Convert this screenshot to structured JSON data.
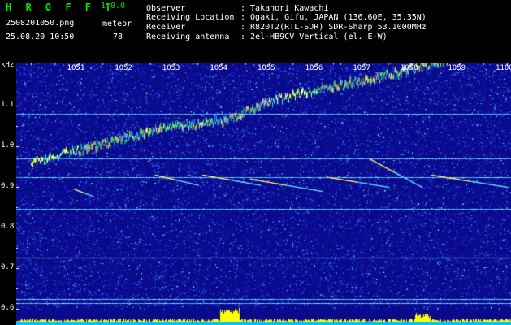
{
  "header": {
    "brand": "H R O F F T",
    "version": "1.0.0",
    "filename": "2508201050.png",
    "datetime": "25.08.20 10:50",
    "meteor_label": "meteor",
    "meteor_count": "78"
  },
  "info": [
    {
      "label": "Observer",
      "value": ": Takanori Kawachi"
    },
    {
      "label": "Receiving Location",
      "value": ": Ogaki, Gifu, JAPAN (136.60E, 35.35N)"
    },
    {
      "label": "Receiver",
      "value": ": R820T2(RTL-SDR) SDR-Sharp 53.1000MHz"
    },
    {
      "label": "Receiving antenna",
      "value": ": 2el-HB9CV Vertical (el. E-W)"
    }
  ],
  "colors": {
    "brand": "#00e000",
    "text": "#ffffff",
    "background": "#000000",
    "spectrogram_bg": "#0a0a8c",
    "signal": "#ffff00"
  },
  "chart_data": {
    "type": "heatmap",
    "y_unit": "kHz",
    "y_ticks": [
      "1.1",
      "1.0",
      "0.9",
      "0.8",
      "0.7",
      "0.6"
    ],
    "x_ticks": [
      "1051",
      "1052",
      "1053",
      "1054",
      "1055",
      "1056",
      "1057",
      "1058",
      "1059",
      "1100"
    ],
    "carriers_khz": [
      1.08,
      0.97,
      0.925,
      0.847,
      0.727,
      0.625,
      0.615
    ],
    "drifting_trace": [
      {
        "t": 1050.0,
        "f": 0.96
      },
      {
        "t": 1051.0,
        "f": 0.99
      },
      {
        "t": 1052.0,
        "f": 1.02
      },
      {
        "t": 1053.0,
        "f": 1.05
      },
      {
        "t": 1054.0,
        "f": 1.06
      },
      {
        "t": 1055.0,
        "f": 1.11
      },
      {
        "t": 1056.0,
        "f": 1.14
      },
      {
        "t": 1057.0,
        "f": 1.16
      },
      {
        "t": 1058.0,
        "f": 1.19
      },
      {
        "t": 1059.0,
        "f": 1.22
      },
      {
        "t": 1100.0,
        "f": 1.24
      }
    ],
    "meteor_streaks": [
      {
        "t0": 1050.9,
        "f0": 0.895,
        "t1": 1051.3,
        "f1": 0.877
      },
      {
        "t0": 1052.6,
        "f0": 0.93,
        "t1": 1053.5,
        "f1": 0.905
      },
      {
        "t0": 1053.6,
        "f0": 0.93,
        "t1": 1054.8,
        "f1": 0.905
      },
      {
        "t0": 1054.6,
        "f0": 0.92,
        "t1": 1056.1,
        "f1": 0.89
      },
      {
        "t0": 1056.2,
        "f0": 0.925,
        "t1": 1057.5,
        "f1": 0.9
      },
      {
        "t0": 1057.1,
        "f0": 0.97,
        "t1": 1058.2,
        "f1": 0.9
      },
      {
        "t0": 1058.4,
        "f0": 0.93,
        "t1": 1100.0,
        "f1": 0.9
      }
    ]
  }
}
